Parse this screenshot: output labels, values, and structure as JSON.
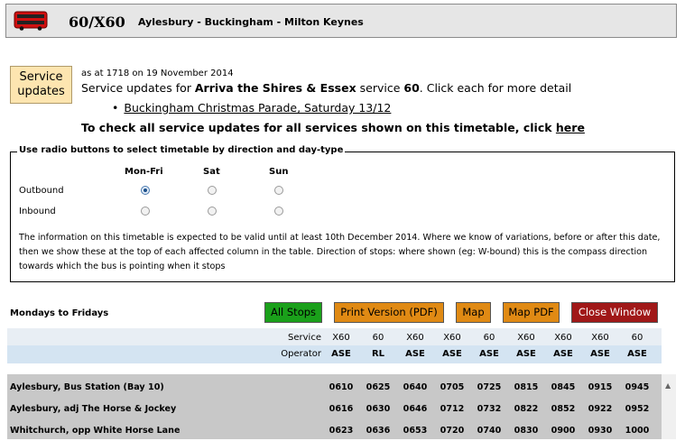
{
  "header": {
    "route_number": "60/X60",
    "route_description": "Aylesbury - Buckingham - Milton Keynes",
    "icon": "bus-icon",
    "icon_color": "#d01010"
  },
  "service_updates": {
    "badge_line1": "Service",
    "badge_line2": "updates",
    "as_at": "as at 1718 on 19 November 2014",
    "intro_prefix": "Service updates for ",
    "operator": "Arriva the Shires & Essex",
    "intro_mid": " service ",
    "service": "60",
    "intro_suffix": ". Click each for more detail",
    "items": [
      "Buckingham Christmas Parade, Saturday 13/12"
    ],
    "check_all_prefix": "To check all service updates for all services shown on this timetable, click ",
    "check_all_link": "here"
  },
  "selector": {
    "legend": "Use radio buttons to select timetable by direction and day-type",
    "days": [
      "Mon-Fri",
      "Sat",
      "Sun"
    ],
    "directions": [
      "Outbound",
      "Inbound"
    ],
    "selected": {
      "direction": "Outbound",
      "day": "Mon-Fri"
    },
    "info": "The information on this timetable is expected to be valid until at least 10th December 2014. Where we know of variations, before or after this date, then we show these at the top of each affected column in the table.  Direction of stops: where shown (eg: W-bound) this is the compass direction towards which the bus is pointing when it stops"
  },
  "toolbar": {
    "section_title": "Mondays to Fridays",
    "all_stops": "All Stops",
    "print_version": "Print Version (PDF)",
    "map": "Map",
    "map_pdf": "Map PDF",
    "close_window": "Close Window",
    "colors": {
      "green": "#1aa01a",
      "orange": "#e08a14",
      "red": "#a01818"
    }
  },
  "timetable": {
    "service_label": "Service",
    "operator_label": "Operator",
    "services": [
      "X60",
      "60",
      "X60",
      "X60",
      "60",
      "X60",
      "X60",
      "X60",
      "60"
    ],
    "operators": [
      "ASE",
      "RL",
      "ASE",
      "ASE",
      "ASE",
      "ASE",
      "ASE",
      "ASE",
      "ASE"
    ],
    "stops": [
      {
        "name": "Aylesbury, Bus Station (Bay 10)",
        "times": [
          "0610",
          "0625",
          "0640",
          "0705",
          "0725",
          "0815",
          "0845",
          "0915",
          "0945"
        ]
      },
      {
        "name": "Aylesbury, adj The Horse & Jockey",
        "times": [
          "0616",
          "0630",
          "0646",
          "0712",
          "0732",
          "0822",
          "0852",
          "0922",
          "0952"
        ]
      },
      {
        "name": "Whitchurch, opp White Horse Lane",
        "times": [
          "0623",
          "0636",
          "0653",
          "0720",
          "0740",
          "0830",
          "0900",
          "0930",
          "1000"
        ]
      }
    ]
  }
}
